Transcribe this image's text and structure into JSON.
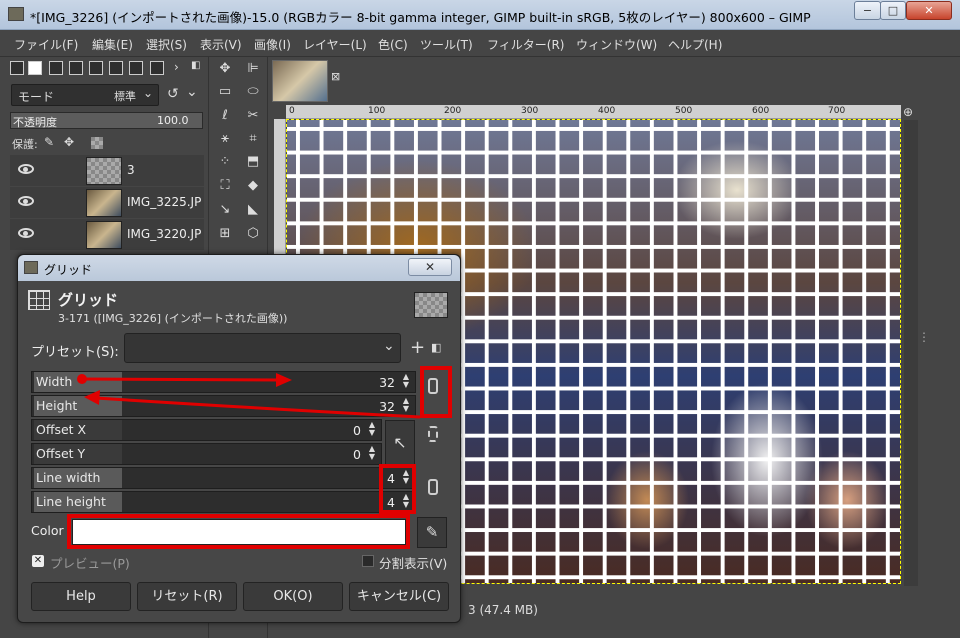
{
  "window": {
    "title": "*[IMG_3226] (インポートされた画像)-15.0 (RGBカラー 8-bit gamma integer, GIMP built-in sRGB, 5枚のレイヤー) 800x600 – GIMP",
    "minimize": "−",
    "maximize": "□",
    "close": "✕"
  },
  "menu": [
    "ファイル(F)",
    "編集(E)",
    "選択(S)",
    "表示(V)",
    "画像(I)",
    "レイヤー(L)",
    "色(C)",
    "ツール(T)",
    "フィルター(R)",
    "ウィンドウ(W)",
    "ヘルプ(H)"
  ],
  "layers_panel": {
    "mode_label": "モード",
    "mode_value": "標準",
    "opacity_label": "不透明度",
    "opacity_value": "100.0",
    "lock_label": "保護:",
    "layers": [
      {
        "name": "3"
      },
      {
        "name": "IMG_3225.JP"
      },
      {
        "name": "IMG_3220.JP"
      }
    ]
  },
  "ruler": {
    "labels": [
      "0",
      "100",
      "200",
      "300",
      "400",
      "500",
      "600",
      "700"
    ]
  },
  "status": {
    "text": "3 (47.4 MB)"
  },
  "dialog": {
    "title": "グリッド",
    "heading": "グリッド",
    "subheading": "3-171 ([IMG_3226] (インポートされた画像))",
    "preset_label": "プリセット(S):",
    "preset_value": "",
    "fields": {
      "width": {
        "label": "Width",
        "value": "32"
      },
      "height": {
        "label": "Height",
        "value": "32"
      },
      "offset_x": {
        "label": "Offset X",
        "value": "0"
      },
      "offset_y": {
        "label": "Offset Y",
        "value": "0"
      },
      "line_width": {
        "label": "Line width",
        "value": "4"
      },
      "line_height": {
        "label": "Line height",
        "value": "4"
      }
    },
    "color_label": "Color",
    "color_value": "#ffffff",
    "preview_label": "プレビュー(P)",
    "split_label": "分割表示(V)",
    "buttons": {
      "help": "Help",
      "reset": "リセット(R)",
      "ok": "OK(O)",
      "cancel": "キャンセル(C)"
    }
  },
  "annotation_color": "#e00000"
}
